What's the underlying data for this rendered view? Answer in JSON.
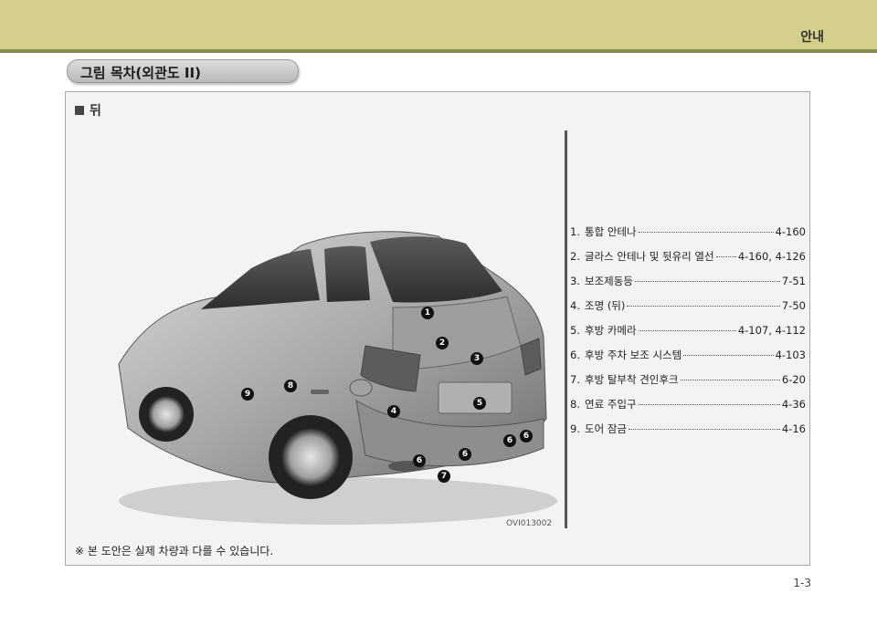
{
  "header": {
    "section": "안내"
  },
  "title": "그림 목차(외관도 II)",
  "view": {
    "heading": "뒤"
  },
  "figure": {
    "code": "OVI013002"
  },
  "callouts": [
    "1",
    "2",
    "3",
    "4",
    "5",
    "6",
    "6",
    "6",
    "6",
    "7",
    "8",
    "9"
  ],
  "legend": [
    {
      "num": "1.",
      "label": "통합 안테나",
      "page": "4-160"
    },
    {
      "num": "2.",
      "label": "글라스 안테나 및 뒷유리 열선",
      "page": "4-160, 4-126"
    },
    {
      "num": "3.",
      "label": "보조제동등",
      "page": "7-51"
    },
    {
      "num": "4.",
      "label": "조명 (뒤)",
      "page": "7-50"
    },
    {
      "num": "5.",
      "label": "후방 카메라",
      "page": "4-107, 4-112"
    },
    {
      "num": "6.",
      "label": "후방 주차 보조 시스템",
      "page": "4-103"
    },
    {
      "num": "7.",
      "label": "후방 탈부착 견인후크",
      "page": "6-20"
    },
    {
      "num": "8.",
      "label": "연료 주입구",
      "page": "4-36"
    },
    {
      "num": "9.",
      "label": "도어 잠금",
      "page": "4-16"
    }
  ],
  "footnote": "※ 본 도안은 실제 차량과 다를 수 있습니다.",
  "page_number": "1-3"
}
